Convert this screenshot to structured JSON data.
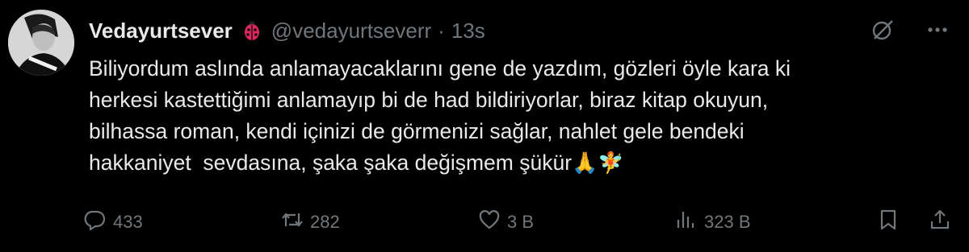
{
  "tweet": {
    "display_name": "Vedayurtsever",
    "handle": "@vedayurtseverr",
    "separator": "·",
    "time": "13s",
    "text_lines": [
      "Biliyordum aslında anlamayacaklarını gene de yazdım, gözleri öyle kara ki",
      "herkesi kastettiğimi anlamayıp bi de had bildiriyorlar, biraz kitap okuyun,",
      "bilhassa roman, kendi içinizi de görmenizi sağlar, nahlet gele bendeki",
      "hakkaniyet  sevdasına, şaka şaka değişmem şükür"
    ],
    "emojis": "🙏🧚"
  },
  "actions": {
    "replies": "433",
    "reposts": "282",
    "likes": "3 B",
    "views": "323 B"
  },
  "icons": {
    "badge": "ladybug-icon",
    "grok": "grok-icon",
    "more": "more-icon",
    "reply": "reply-icon",
    "repost": "repost-icon",
    "like": "heart-icon",
    "views": "views-icon",
    "bookmark": "bookmark-icon",
    "share": "share-icon"
  },
  "colors": {
    "background": "#000000",
    "text": "#e7e9ea",
    "muted": "#71767b",
    "badge": "#e0245e"
  }
}
